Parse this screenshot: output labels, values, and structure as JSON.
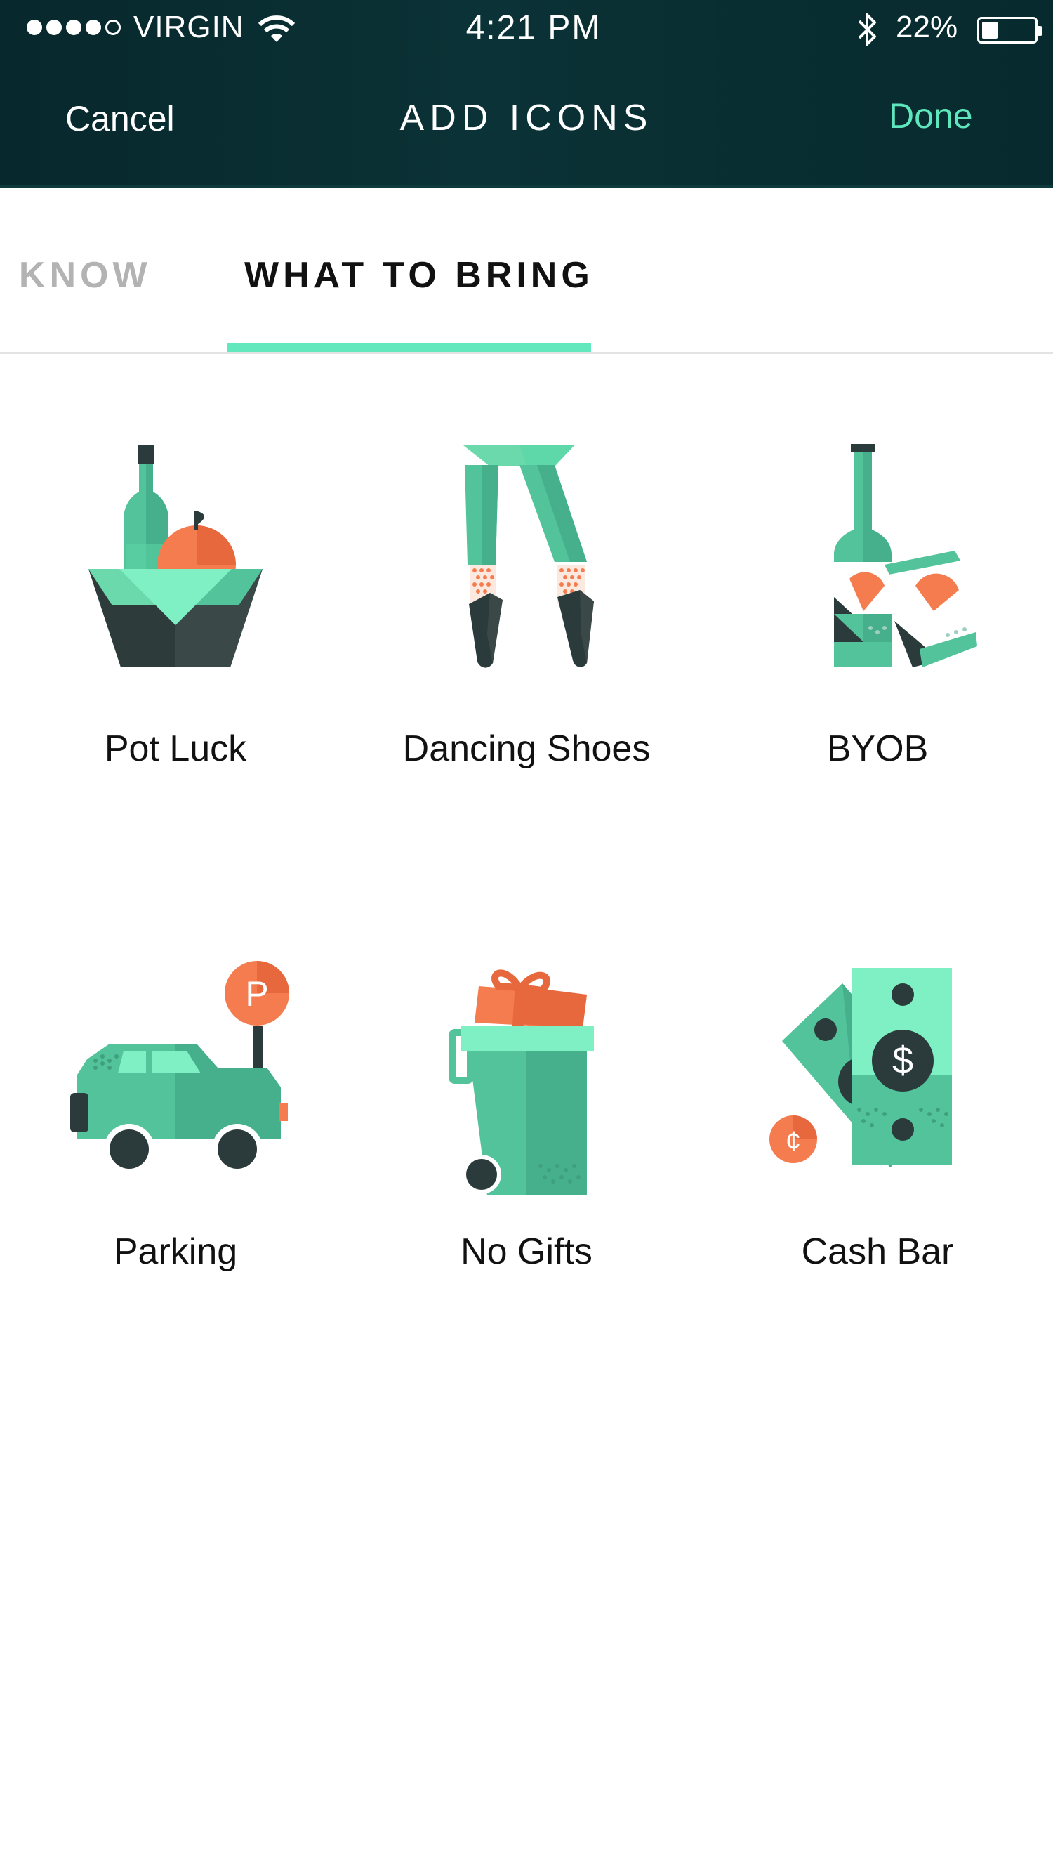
{
  "status_bar": {
    "carrier": "VIRGIN",
    "time": "4:21 PM",
    "battery_percent": "22%",
    "signal_bars": 4,
    "signal_total": 5,
    "battery_level": 0.22
  },
  "nav": {
    "cancel_label": "Cancel",
    "title": "ADD ICONS",
    "done_label": "Done"
  },
  "tabs": [
    {
      "label": "O KNOW",
      "active": false
    },
    {
      "label": "WHAT TO BRING",
      "active": true
    }
  ],
  "icons": [
    {
      "label": "Pot Luck",
      "icon": "pot-luck-icon"
    },
    {
      "label": "Dancing Shoes",
      "icon": "dancing-shoes-icon"
    },
    {
      "label": "BYOB",
      "icon": "byob-icon"
    },
    {
      "label": "Parking",
      "icon": "parking-icon"
    },
    {
      "label": "No Gifts",
      "icon": "no-gifts-icon"
    },
    {
      "label": "Cash Bar",
      "icon": "cash-bar-icon"
    }
  ],
  "colors": {
    "nav_bg": "#0a2e32",
    "accent": "#63e8bd",
    "green": "#52c39a",
    "dark": "#2b3a3a",
    "orange": "#f47c4f"
  }
}
